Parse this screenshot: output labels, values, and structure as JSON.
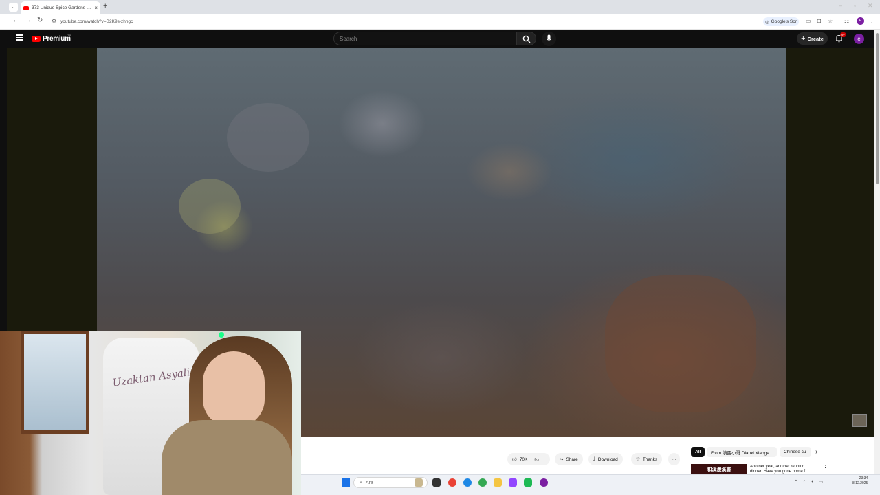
{
  "browser": {
    "tab_title": "373 Unique Spice Gardens of t",
    "url": "youtube.com/watch?v=B2K9s-zhngc",
    "google_search_chip": "Google's Sor"
  },
  "youtube": {
    "logo_text": "Premium",
    "region": "TR",
    "search_placeholder": "Search",
    "create_label": "Create",
    "notification_count": "9+",
    "avatar_letter": "e"
  },
  "webcam": {
    "chair_text": "Uzaktan Asyali"
  },
  "actions": {
    "like_count": "70K",
    "share_label": "Share",
    "download_label": "Download",
    "thanks_label": "Thanks",
    "more": "···"
  },
  "chips": {
    "all": "All",
    "from_channel": "From 滇西小哥 Dianxi Xiaoge",
    "chinese": "Chinese cu"
  },
  "recommendation": {
    "thumb_text": "和溪漫溪書",
    "title": "Another year, another reunion dinner. Have you gone home f"
  },
  "taskbar": {
    "search_placeholder": "Ara",
    "time": "23:34",
    "date": "8.12.2025"
  },
  "colors": {
    "accent": "#ff0000",
    "avatar": "#7b1fa2"
  }
}
